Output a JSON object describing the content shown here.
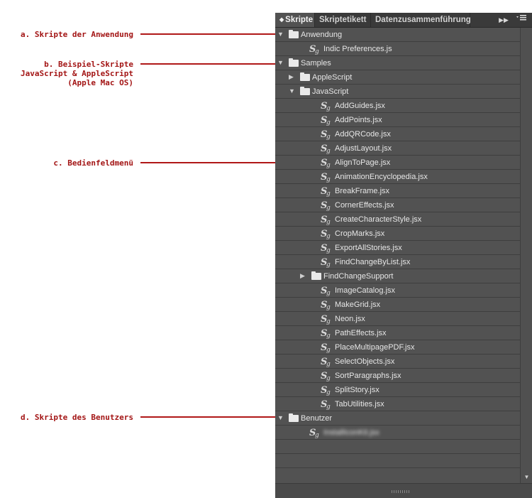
{
  "annotations": {
    "a": "a. Skripte der Anwendung",
    "b": [
      "b. Beispiel-Skripte",
      "JavaScript & AppleScript",
      "(Apple Mac OS)"
    ],
    "c": "c. Bedienfeldmenü",
    "d": "d. Skripte des Benutzers"
  },
  "panel": {
    "tabs": [
      "Skripte",
      "Skriptetikett",
      "Datenzusammenführung"
    ],
    "active_tab": "Skripte",
    "collapse_icon": "double-chevron-right-icon",
    "menu_icon": "panel-menu-icon"
  },
  "tree": [
    {
      "label": "Anwendung",
      "type": "folder",
      "twisty": "expanded"
    },
    {
      "label": "Indic Preferences.js",
      "type": "script"
    },
    {
      "label": "Samples",
      "type": "folder",
      "twisty": "expanded"
    },
    {
      "label": "AppleScript",
      "type": "folder",
      "twisty": "collapsed"
    },
    {
      "label": "JavaScript",
      "type": "folder",
      "twisty": "expanded"
    },
    {
      "label": "AddGuides.jsx",
      "type": "script"
    },
    {
      "label": "AddPoints.jsx",
      "type": "script"
    },
    {
      "label": "AddQRCode.jsx",
      "type": "script"
    },
    {
      "label": "AdjustLayout.jsx",
      "type": "script"
    },
    {
      "label": "AlignToPage.jsx",
      "type": "script"
    },
    {
      "label": "AnimationEncyclopedia.jsx",
      "type": "script"
    },
    {
      "label": "BreakFrame.jsx",
      "type": "script"
    },
    {
      "label": "CornerEffects.jsx",
      "type": "script"
    },
    {
      "label": "CreateCharacterStyle.jsx",
      "type": "script"
    },
    {
      "label": "CropMarks.jsx",
      "type": "script"
    },
    {
      "label": "ExportAllStories.jsx",
      "type": "script"
    },
    {
      "label": "FindChangeByList.jsx",
      "type": "script"
    },
    {
      "label": "FindChangeSupport",
      "type": "folder",
      "twisty": "collapsed"
    },
    {
      "label": "ImageCatalog.jsx",
      "type": "script"
    },
    {
      "label": "MakeGrid.jsx",
      "type": "script"
    },
    {
      "label": "Neon.jsx",
      "type": "script"
    },
    {
      "label": "PathEffects.jsx",
      "type": "script"
    },
    {
      "label": "PlaceMultipagePDF.jsx",
      "type": "script"
    },
    {
      "label": "SelectObjects.jsx",
      "type": "script"
    },
    {
      "label": "SortParagraphs.jsx",
      "type": "script"
    },
    {
      "label": "SplitStory.jsx",
      "type": "script"
    },
    {
      "label": "TabUtilities.jsx",
      "type": "script"
    },
    {
      "label": "Benutzer",
      "type": "folder",
      "twisty": "expanded"
    },
    {
      "label": "InstallIconKit.jsx",
      "type": "script",
      "blurred": true
    },
    {
      "label": "",
      "type": "empty"
    },
    {
      "label": "",
      "type": "empty"
    }
  ],
  "colors": {
    "panel_bg": "#525252",
    "annotation": "#a31515"
  }
}
